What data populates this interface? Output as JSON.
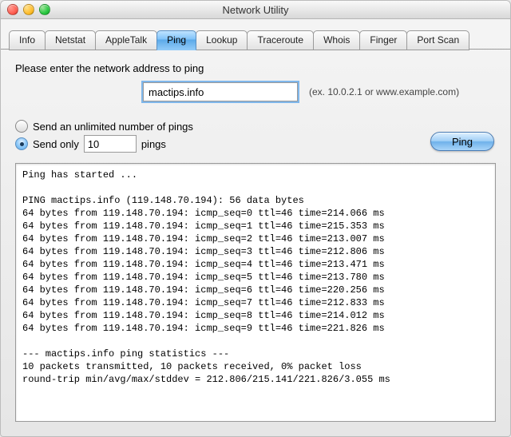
{
  "window": {
    "title": "Network Utility"
  },
  "tabs": [
    {
      "label": "Info",
      "active": false
    },
    {
      "label": "Netstat",
      "active": false
    },
    {
      "label": "AppleTalk",
      "active": false
    },
    {
      "label": "Ping",
      "active": true
    },
    {
      "label": "Lookup",
      "active": false
    },
    {
      "label": "Traceroute",
      "active": false
    },
    {
      "label": "Whois",
      "active": false
    },
    {
      "label": "Finger",
      "active": false
    },
    {
      "label": "Port Scan",
      "active": false
    }
  ],
  "ping": {
    "prompt": "Please enter the network address to ping",
    "address_value": "mactips.info",
    "example_hint": "(ex. 10.0.2.1 or www.example.com)",
    "unlimited_label": "Send an unlimited number of pings",
    "send_only_prefix": "Send only",
    "send_only_suffix": "pings",
    "count_value": "10",
    "selected_mode": "limited",
    "button_label": "Ping",
    "output": "Ping has started ...\n\nPING mactips.info (119.148.70.194): 56 data bytes\n64 bytes from 119.148.70.194: icmp_seq=0 ttl=46 time=214.066 ms\n64 bytes from 119.148.70.194: icmp_seq=1 ttl=46 time=215.353 ms\n64 bytes from 119.148.70.194: icmp_seq=2 ttl=46 time=213.007 ms\n64 bytes from 119.148.70.194: icmp_seq=3 ttl=46 time=212.806 ms\n64 bytes from 119.148.70.194: icmp_seq=4 ttl=46 time=213.471 ms\n64 bytes from 119.148.70.194: icmp_seq=5 ttl=46 time=213.780 ms\n64 bytes from 119.148.70.194: icmp_seq=6 ttl=46 time=220.256 ms\n64 bytes from 119.148.70.194: icmp_seq=7 ttl=46 time=212.833 ms\n64 bytes from 119.148.70.194: icmp_seq=8 ttl=46 time=214.012 ms\n64 bytes from 119.148.70.194: icmp_seq=9 ttl=46 time=221.826 ms\n\n--- mactips.info ping statistics ---\n10 packets transmitted, 10 packets received, 0% packet loss\nround-trip min/avg/max/stddev = 212.806/215.141/221.826/3.055 ms"
  }
}
